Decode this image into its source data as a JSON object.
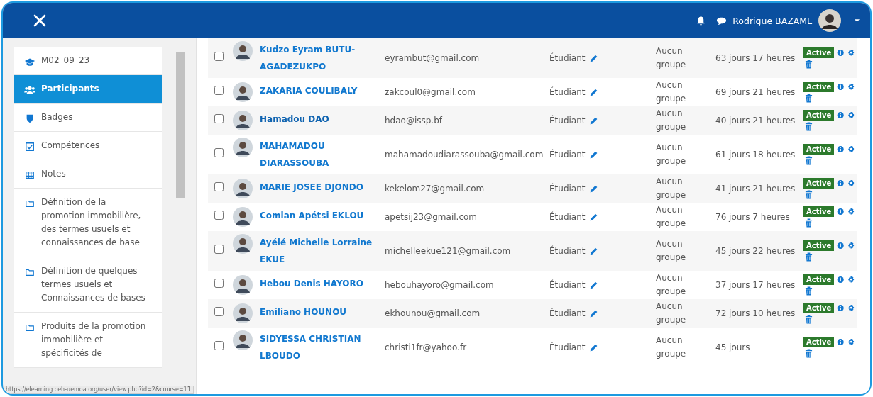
{
  "header": {
    "user_name": "Rodrigue BAZAME"
  },
  "sidebar": {
    "items": [
      {
        "label": "M02_09_23",
        "selected": false
      },
      {
        "label": "Participants",
        "selected": true
      },
      {
        "label": "Badges",
        "selected": false
      },
      {
        "label": "Compétences",
        "selected": false
      },
      {
        "label": "Notes",
        "selected": false
      },
      {
        "label": "Définition de la promotion immobilière, des termes usuels et connaissances de base",
        "selected": false
      },
      {
        "label": "Définition de quelques termes usuels et Connaissances de bases",
        "selected": false
      },
      {
        "label": "Produits de la promotion immobilière et spécificités de",
        "selected": false
      }
    ]
  },
  "table": {
    "rows": [
      {
        "checked": false,
        "name": "Kudzo Eyram BUTU-AGADEZUKPO",
        "hovered": false,
        "email": "eyrambut@gmail.com",
        "role": "Étudiant",
        "group": "Aucun groupe",
        "last_access": "63 jours 17 heures",
        "status": "Active"
      },
      {
        "checked": false,
        "name": "ZAKARIA COULIBALY",
        "hovered": false,
        "email": "zakcoul0@gmail.com",
        "role": "Étudiant",
        "group": "Aucun groupe",
        "last_access": "69 jours 21 heures",
        "status": "Active"
      },
      {
        "checked": false,
        "name": "Hamadou DAO",
        "hovered": true,
        "email": "hdao@issp.bf",
        "role": "Étudiant",
        "group": "Aucun groupe",
        "last_access": "40 jours 21 heures",
        "status": "Active"
      },
      {
        "checked": false,
        "name": "MAHAMADOU DIARASSOUBA",
        "hovered": false,
        "email": "mahamadoudiarassouba@gmail.com",
        "role": "Étudiant",
        "group": "Aucun groupe",
        "last_access": "61 jours 18 heures",
        "status": "Active"
      },
      {
        "checked": false,
        "name": "MARIE JOSEE DJONDO",
        "hovered": false,
        "email": "kekelom27@gmail.com",
        "role": "Étudiant",
        "group": "Aucun groupe",
        "last_access": "41 jours 21 heures",
        "status": "Active"
      },
      {
        "checked": false,
        "name": "Comlan Apétsi EKLOU",
        "hovered": false,
        "email": "apetsij23@gmail.com",
        "role": "Étudiant",
        "group": "Aucun groupe",
        "last_access": "76 jours 7 heures",
        "status": "Active"
      },
      {
        "checked": false,
        "name": "Ayélé Michelle Lorraine EKUE",
        "hovered": false,
        "email": "michelleekue121@gmail.com",
        "role": "Étudiant",
        "group": "Aucun groupe",
        "last_access": "45 jours 22 heures",
        "status": "Active"
      },
      {
        "checked": false,
        "name": "Hebou Denis HAYORO",
        "hovered": false,
        "email": "hebouhayoro@gmail.com",
        "role": "Étudiant",
        "group": "Aucun groupe",
        "last_access": "37 jours 17 heures",
        "status": "Active"
      },
      {
        "checked": false,
        "name": "Emiliano HOUNOU",
        "hovered": false,
        "email": "ekhounou@gmail.com",
        "role": "Étudiant",
        "group": "Aucun groupe",
        "last_access": "72 jours 10 heures",
        "status": "Active"
      },
      {
        "checked": false,
        "name": "SIDYESSA CHRISTIAN LBOUDO",
        "hovered": false,
        "email": "christi1fr@yahoo.fr",
        "role": "Étudiant",
        "group": "Aucun groupe",
        "last_access": "45 jours",
        "status": "Active"
      }
    ]
  },
  "status_bar": {
    "url": "https://elearning.ceh-uemoa.org/user/view.php?id=2&course=11"
  }
}
